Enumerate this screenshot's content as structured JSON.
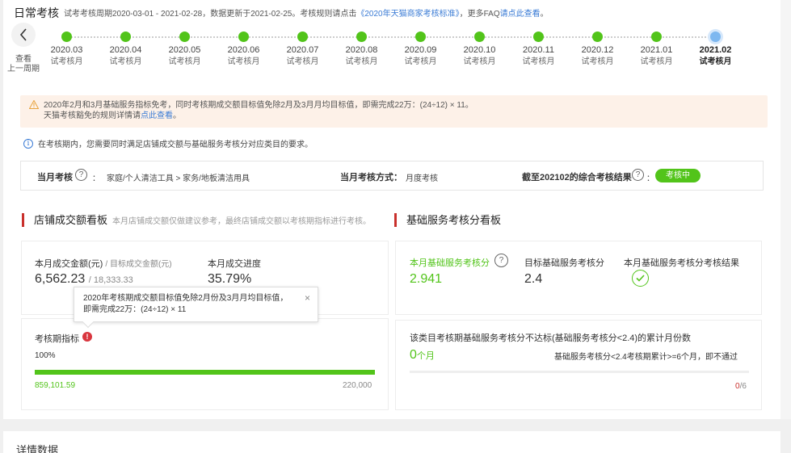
{
  "header": {
    "title": "日常考核",
    "desc_prefix": "试考考核周期2020-03-01 - 2021-02-28，数据更新于2021-02-25。考核规则请点击",
    "desc_link": "《2020年天猫商家考核标准》",
    "desc_mid": "，更多FAQ",
    "desc_link2": "请点此查看",
    "desc_suffix": "。"
  },
  "back": {
    "label_line1": "查看",
    "label_line2": "上一周期"
  },
  "timeline": [
    {
      "date": "2020.03",
      "type": "试考核月"
    },
    {
      "date": "2020.04",
      "type": "试考核月"
    },
    {
      "date": "2020.05",
      "type": "试考核月"
    },
    {
      "date": "2020.06",
      "type": "试考核月"
    },
    {
      "date": "2020.07",
      "type": "试考核月"
    },
    {
      "date": "2020.08",
      "type": "试考核月"
    },
    {
      "date": "2020.09",
      "type": "试考核月"
    },
    {
      "date": "2020.10",
      "type": "试考核月"
    },
    {
      "date": "2020.11",
      "type": "试考核月"
    },
    {
      "date": "2020.12",
      "type": "试考核月"
    },
    {
      "date": "2021.01",
      "type": "试考核月"
    },
    {
      "date": "2021.02",
      "type": "试考核月"
    }
  ],
  "notice": {
    "line1": "2020年2月和3月基础服务指标免考，同时考核期成交额目标值免除2月及3月月均目标值，即需完成22万：(24÷12) × 11。",
    "line2_prefix": "天猫考核豁免的规则详情请",
    "line2_link": "点此查看",
    "line2_suffix": "。"
  },
  "info": {
    "text": "在考核期内，您需要同时满足店铺成交额与基础服务考核分对应类目的要求。"
  },
  "summary": {
    "assess_label": "当月考核",
    "assess_value": "家庭/个人清洁工具 > 家务/地板清洁用具",
    "method_label": "当月考核方式：",
    "method_value": "月度考核",
    "result_label": "截至202102的综合考核结果",
    "colon": "：",
    "result_badge": "考核中"
  },
  "sales": {
    "title": "店铺成交额看板",
    "subtitle": "本月店铺成交额仅做建议参考，最终店铺成交额以考核期指标进行考核。",
    "amount_label": "本月成交金额(元)",
    "target_label": "/ 目标成交金额(元)",
    "amount_value": "6,562.23",
    "target_value": "/ 18,333.33",
    "progress_label": "本月成交进度",
    "progress_value": "35.79%",
    "period_label": "考核期指标",
    "period_percent": "100%",
    "period_fill": 1.0,
    "period_actual": "859,101.59",
    "period_target": "220,000"
  },
  "tooltip": {
    "line1": "2020年考核期成交额目标值免除2月份及3月月均目标值，",
    "line2": "即需完成22万：(24÷12) × 11"
  },
  "service": {
    "title": "基础服务考核分看板",
    "score_label": "本月基础服务考核分",
    "score_value": "2.941",
    "target_label": "目标基础服务考核分",
    "target_value": "2.4",
    "result_label": "本月基础服务考核分考核结果",
    "count_label": "该类目考核期基础服务考核分不达标(基础服务考核分<2.4)的累计月份数",
    "count_value": "0",
    "count_unit": "个月",
    "count_rule": "基础服务考核分<2.4考核期累计>=6个月，即不通过",
    "count_ratio_num": "0",
    "count_ratio_den": "/6"
  },
  "footer": {
    "title": "详情数据"
  }
}
